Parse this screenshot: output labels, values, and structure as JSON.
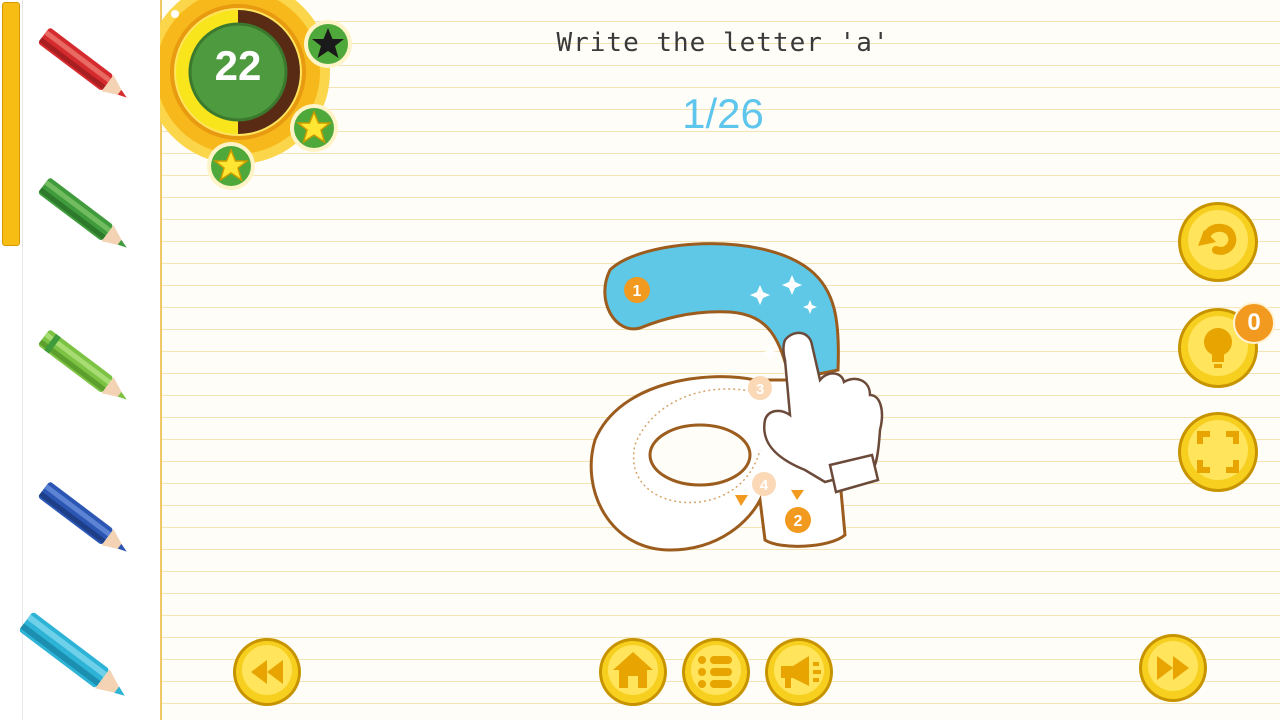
{
  "header": {
    "instruction": "Write the letter 'a'",
    "progress": "1/26"
  },
  "timer": {
    "value": "22"
  },
  "badge_stars": [
    {
      "icon": "star-dark-icon"
    },
    {
      "icon": "star-yellow-icon"
    },
    {
      "icon": "star-yellow-icon"
    }
  ],
  "pencils": [
    {
      "name": "red",
      "color": "#d62b2e"
    },
    {
      "name": "green",
      "color": "#3f9b3c"
    },
    {
      "name": "light-green",
      "color": "#7cc243"
    },
    {
      "name": "blue",
      "color": "#2b56b4"
    },
    {
      "name": "cyan",
      "color": "#2cb3d6"
    }
  ],
  "letter_trace": {
    "letter": "a",
    "stroke_numbers": [
      "1",
      "2",
      "3",
      "4"
    ],
    "filled_color": "#5ec8e6",
    "outline_color": "#9b5c1e"
  },
  "side_buttons": {
    "undo_icon": "undo-icon",
    "hint_icon": "lightbulb-icon",
    "hint_count": "0",
    "fullscreen_icon": "fullscreen-icon"
  },
  "bottom_buttons": {
    "previous_icon": "rewind-icon",
    "home_icon": "home-icon",
    "menu_icon": "list-icon",
    "sound_icon": "megaphone-icon",
    "next_icon": "fast-forward-icon"
  },
  "colors": {
    "gold": "#f7cf1e",
    "accent_blue": "#5ec5ec",
    "badge_orange": "#f29a1f",
    "timer_green": "#4e9a3f"
  }
}
